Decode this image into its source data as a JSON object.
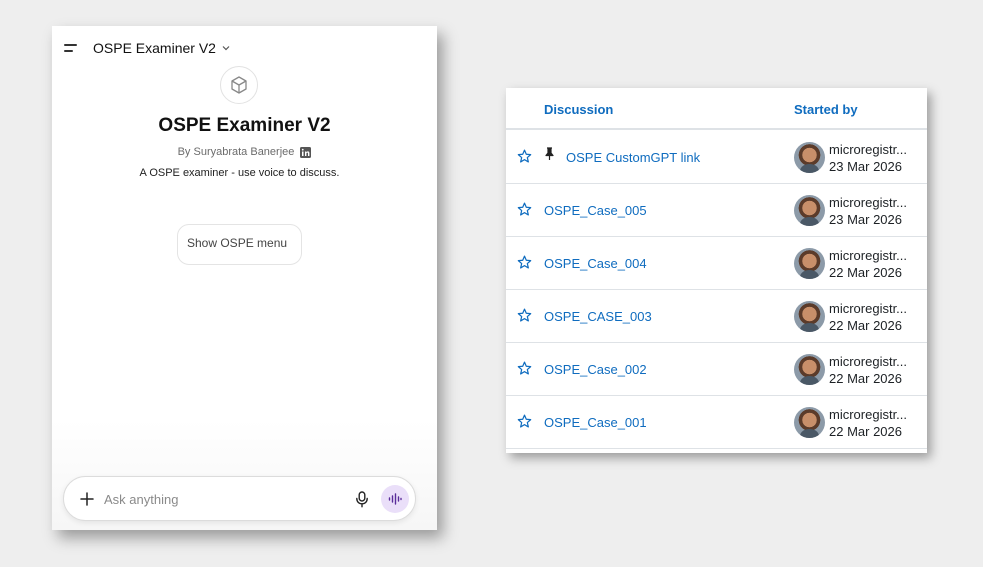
{
  "chat": {
    "header_title": "OSPE Examiner V2",
    "title": "OSPE Examiner V2",
    "author": "By Suryabrata Banerjee",
    "description": "A OSPE examiner - use voice to discuss.",
    "starter": "Show OSPE menu",
    "input_placeholder": "Ask anything"
  },
  "forum": {
    "header_discussion": "Discussion",
    "header_started_by": "Started by",
    "rows": [
      {
        "title": "OSPE CustomGPT link",
        "pinned": true,
        "user": "microregistr...",
        "date": "23 Mar 2026"
      },
      {
        "title": "OSPE_Case_005",
        "pinned": false,
        "user": "microregistr...",
        "date": "23 Mar 2026"
      },
      {
        "title": "OSPE_Case_004",
        "pinned": false,
        "user": "microregistr...",
        "date": "22 Mar 2026"
      },
      {
        "title": "OSPE_CASE_003",
        "pinned": false,
        "user": "microregistr...",
        "date": "22 Mar 2026"
      },
      {
        "title": "OSPE_Case_002",
        "pinned": false,
        "user": "microregistr...",
        "date": "22 Mar 2026"
      },
      {
        "title": "OSPE_Case_001",
        "pinned": false,
        "user": "microregistr...",
        "date": "22 Mar 2026"
      }
    ]
  },
  "icons": {
    "menu": "menu-icon",
    "chevron": "chevron-down-icon",
    "gpt_avatar": "cube-icon",
    "linkedin": "linkedin-icon",
    "plus": "plus-icon",
    "mic": "microphone-icon",
    "voice": "voice-mode-icon",
    "star": "star-icon",
    "pin": "pin-icon"
  },
  "colors": {
    "link": "#0f6cbf",
    "voice_button": "#eadff9"
  }
}
